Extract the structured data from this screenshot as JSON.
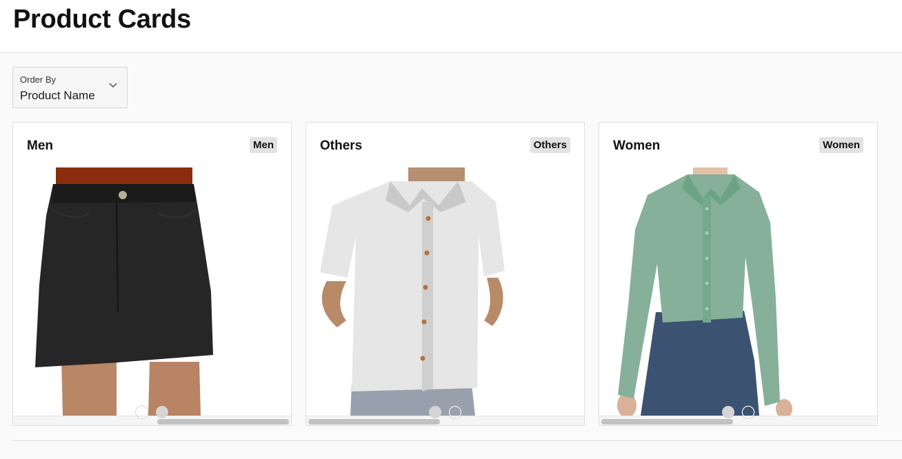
{
  "page": {
    "title": "Product Cards"
  },
  "order_by": {
    "label": "Order By",
    "value": "Product Name"
  },
  "cards": [
    {
      "title": "Men",
      "badge": "Men",
      "image_icon": "shorts-product-photo",
      "carousel": {
        "slides": 2,
        "active_index": 1
      }
    },
    {
      "title": "Others",
      "badge": "Others",
      "image_icon": "shirt-product-photo",
      "carousel": {
        "slides": 2,
        "active_index": 0
      }
    },
    {
      "title": "Women",
      "badge": "Women",
      "image_icon": "blouse-product-photo",
      "carousel": {
        "slides": 2,
        "active_index": 0
      }
    }
  ],
  "colors": {
    "header_bg": "#ffffff",
    "page_bg": "#fafafa",
    "badge_bg": "#e2e2e2",
    "shorts": "#222222",
    "shirt_white": "#e8e8e8",
    "blouse_green": "#86b09a",
    "jeans_blue": "#3a5272"
  }
}
